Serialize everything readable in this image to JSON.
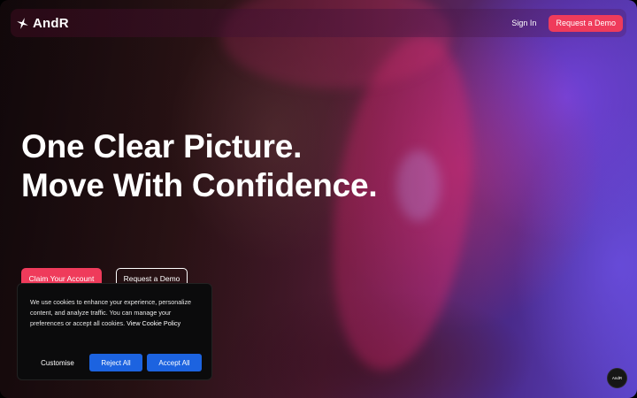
{
  "brand": {
    "name": "AndR",
    "icon": "star-burst-icon"
  },
  "nav": {
    "signin_label": "Sign In",
    "demo_label": "Request a Demo"
  },
  "hero": {
    "headline_line1": "One Clear Picture.",
    "headline_line2": "Move With Confidence.",
    "claim_label": "Claim Your Account",
    "demo_label": "Request a Demo"
  },
  "cookie": {
    "text": "We use cookies to enhance your experience, personalize content, and analyze traffic. You can manage your preferences or accept all cookies.",
    "link_label": "View Cookie Policy",
    "customise_label": "Customise",
    "reject_label": "Reject All",
    "accept_label": "Accept All"
  },
  "badge": {
    "label": "AndR"
  },
  "colors": {
    "accent": "#ef3b5b",
    "cookie_button": "#1c63e0",
    "cookie_bg": "#0b0b0c"
  }
}
